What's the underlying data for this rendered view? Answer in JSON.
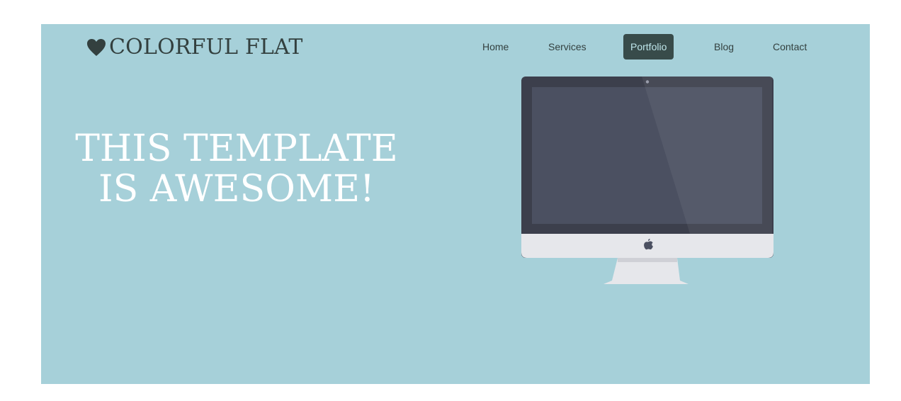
{
  "colors": {
    "hero_bg": "#a6d0d9",
    "dark_text": "#33403f",
    "active_nav_bg": "#384b4a",
    "active_nav_text": "#bfe6ea",
    "monitor_bezel": "#3c3f4c",
    "monitor_screen": "#4b5061",
    "monitor_chin": "#e6e7eb"
  },
  "brand": {
    "icon": "heart-icon",
    "name": "COLORFUL FLAT"
  },
  "nav": {
    "items": [
      {
        "label": "Home",
        "active": false
      },
      {
        "label": "Services",
        "active": false
      },
      {
        "label": "Portfolio",
        "active": true
      },
      {
        "label": "Blog",
        "active": false
      },
      {
        "label": "Contact",
        "active": false
      }
    ]
  },
  "hero": {
    "title_line1": "THIS TEMPLATE",
    "title_line2": "IS AWESOME!",
    "image_icon": "imac-monitor-illustration",
    "logo_icon": "apple-logo-icon"
  }
}
